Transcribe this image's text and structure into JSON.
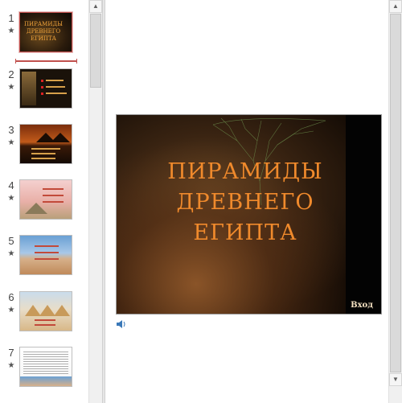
{
  "thumbnails": [
    {
      "number": "1",
      "title": "ПИРАМИДЫ ДРЕВНЕГО ЕГИПТА"
    },
    {
      "number": "2"
    },
    {
      "number": "3"
    },
    {
      "number": "4"
    },
    {
      "number": "5"
    },
    {
      "number": "6"
    },
    {
      "number": "7"
    }
  ],
  "star_glyph": "★",
  "slide": {
    "title": "ПИРАМИДЫ ДРЕВНЕГО ЕГИПТА",
    "button_label": "Вход"
  },
  "colors": {
    "title": "#f08a2c",
    "selection": "#c0504d"
  },
  "icons": {
    "sound": "speaker-icon",
    "scroll_up": "scroll-up-arrow-icon",
    "scroll_down": "scroll-down-arrow-icon"
  }
}
